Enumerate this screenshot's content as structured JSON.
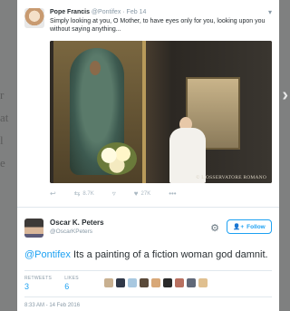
{
  "background": {
    "left_text_lines": [
      "r",
      "at",
      "l",
      "e"
    ],
    "right_nav": "›"
  },
  "original_tweet": {
    "author_name": "Pope Francis",
    "handle": "@Pontifex",
    "date": "· Feb 14",
    "text": "Simply looking at you, O Mother, to have eyes only for you, looking upon you without saying anything...",
    "photo_watermark": "© L'OSSERVATORE ROMANO",
    "actions": {
      "retweets": "8.7K",
      "likes": "27K"
    }
  },
  "reply_tweet": {
    "author_name": "Oscar K. Peters",
    "handle": "@OscarKPeters",
    "follow_label": "Follow",
    "mention": "@Pontifex",
    "text": " Its a painting of a fiction woman god damnit.",
    "stats": {
      "retweets_label": "RETWEETS",
      "retweets_value": "3",
      "likes_label": "LIKES",
      "likes_value": "6"
    },
    "timestamp": "8:33 AM - 14 Feb 2016"
  },
  "colors": {
    "accent": "#1da1f2",
    "muted": "#8899a6",
    "overlay": "#7f8080"
  },
  "icons": [
    "reply-icon",
    "retweet-icon",
    "like-icon",
    "more-icon",
    "gear-icon",
    "follow-user-icon",
    "caret-down-icon"
  ]
}
